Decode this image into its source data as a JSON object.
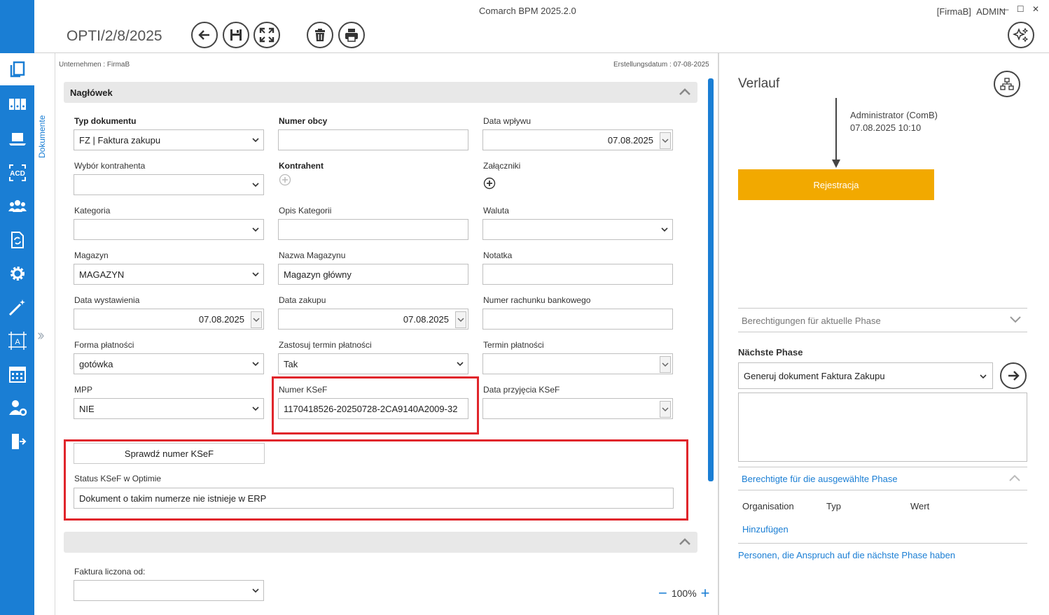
{
  "window": {
    "app_title": "Comarch BPM 2025.2.0",
    "company": "[FirmaB]",
    "user": "ADMIN",
    "controls": "— ☐ ✕"
  },
  "document": {
    "number": "OPTI/2/8/2025",
    "company_meta": "Unternehmen : FirmaB",
    "date_meta": "Erstellungsdatum : 07-08-2025"
  },
  "toolbar": {
    "buttons": [
      "back-arrow-icon",
      "save-icon",
      "fullscreen-icon",
      "delete-icon",
      "print-icon"
    ]
  },
  "sidebar": {
    "vertical_tab": "Dokumente",
    "items": [
      "documents-icon",
      "binders-icon",
      "laptop-icon",
      "ocr-icon",
      "users-icon",
      "refresh-doc-icon",
      "settings-icon",
      "wand-icon",
      "text-frame-icon",
      "calendar-icon",
      "user-settings-icon",
      "logout-icon"
    ]
  },
  "section1": {
    "title": "Nagłówek"
  },
  "fields": {
    "typ_dokumentu": {
      "label": "Typ dokumentu",
      "value": "FZ  |  Faktura zakupu"
    },
    "numer_obcy": {
      "label": "Numer obcy",
      "value": ""
    },
    "data_wplywu": {
      "label": "Data wpływu",
      "value": "07.08.2025"
    },
    "wybor_kontrahenta": {
      "label": "Wybór kontrahenta",
      "value": ""
    },
    "kontrahent": {
      "label": "Kontrahent"
    },
    "zalaczniki": {
      "label": "Załączniki"
    },
    "kategoria": {
      "label": "Kategoria",
      "value": ""
    },
    "opis_kategorii": {
      "label": "Opis Kategorii",
      "value": ""
    },
    "waluta": {
      "label": "Waluta",
      "value": ""
    },
    "magazyn": {
      "label": "Magazyn",
      "value": "MAGAZYN"
    },
    "nazwa_magazynu": {
      "label": "Nazwa Magazynu",
      "value": "Magazyn główny"
    },
    "notatka": {
      "label": "Notatka",
      "value": ""
    },
    "data_wystawienia": {
      "label": "Data wystawienia",
      "value": "07.08.2025"
    },
    "data_zakupu": {
      "label": "Data zakupu",
      "value": "07.08.2025"
    },
    "numer_rachunku": {
      "label": "Numer rachunku bankowego",
      "value": ""
    },
    "forma_platnosci": {
      "label": "Forma płatności",
      "value": "gotówka"
    },
    "zastosuj_termin": {
      "label": "Zastosuj termin płatności",
      "value": "Tak"
    },
    "termin_platnosci": {
      "label": "Termin płatności",
      "value": ""
    },
    "mpp": {
      "label": "MPP",
      "value": "NIE"
    },
    "numer_ksef": {
      "label": "Numer KSeF",
      "value": "1170418526-20250728-2CA9140A2009-32"
    },
    "data_przyjecia_ksef": {
      "label": "Data przyjęcia KSeF",
      "value": ""
    },
    "status_ksef": {
      "label": "Status KSeF w Optimie",
      "value": "Dokument o takim numerze nie istnieje w ERP"
    },
    "faktura_liczona": {
      "label": "Faktura liczona od:",
      "value": ""
    }
  },
  "buttons": {
    "check_ksef": "Sprawdź numer KSeF"
  },
  "zoom": {
    "level": "100%",
    "minus": "−",
    "plus": "+"
  },
  "right_panel": {
    "title": "Verlauf",
    "flow_user": "Administrator (ComB)",
    "flow_time": "07.08.2025 10:10",
    "phase": "Rejestracja",
    "permissions_current": "Berechtigungen für aktuelle Phase",
    "next_phase_label": "Nächste Phase",
    "next_phase_value": "Generuj dokument Faktura Zakupu",
    "permitted_selected": "Berechtigte für die ausgewählte Phase",
    "columns": [
      "Organisation",
      "Typ",
      "Wert"
    ],
    "add_link": "Hinzufügen",
    "entitled_link": "Personen, die Anspruch auf die nächste Phase haben"
  },
  "colors": {
    "accent": "#1a7ed4",
    "phase": "#f2a900",
    "highlight": "#e0252b"
  }
}
